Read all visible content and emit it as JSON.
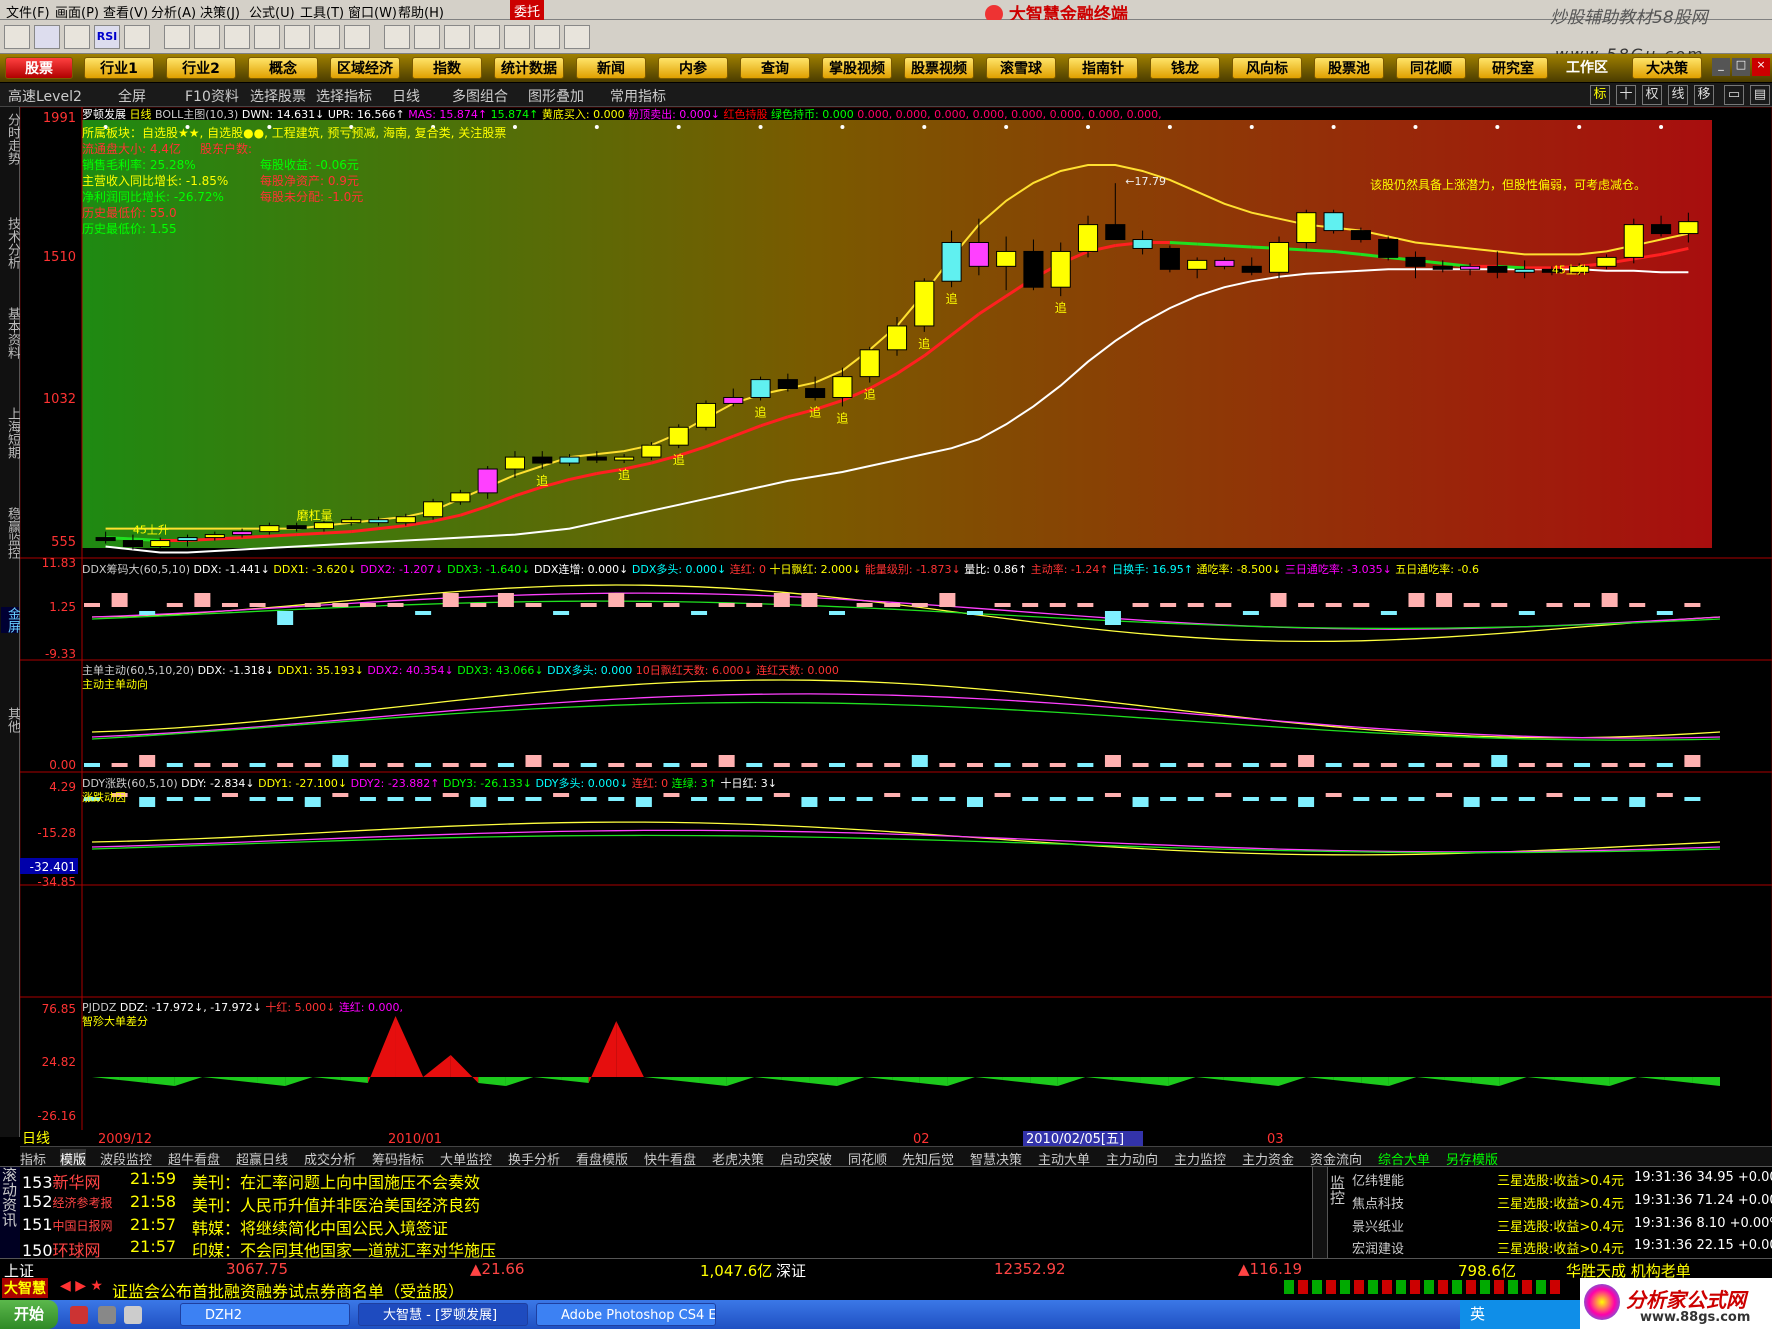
{
  "menu": [
    "文件(F)",
    "画面(P)",
    "查看(V)",
    "分析(A)",
    "决策(J)",
    "公式(U)",
    "工具(T)",
    "窗口(W)",
    "帮助(H)",
    "委托"
  ],
  "app_title": "大智慧金融终端",
  "watermark_site": "炒股辅助教材58股网",
  "watermark_url": "www.58Gu.com",
  "nav": [
    "股票",
    "行业1",
    "行业2",
    "概念",
    "区域经济",
    "指数",
    "统计数据",
    "新闻",
    "内参",
    "查询",
    "掌股视频",
    "股票视频",
    "滚雪球",
    "指南针",
    "钱龙",
    "风向标",
    "股票池",
    "同花顺",
    "研究室",
    "工作区",
    "大决策"
  ],
  "sub": {
    "level2": "高速Level2",
    "full": "全屏",
    "f10": "F10资料",
    "select_stock": "选择股票",
    "select_ind": "选择指标",
    "period": "日线",
    "multi": "多图组合",
    "overlay": "图形叠加",
    "common_ind": "常用指标",
    "right_icons": [
      "标",
      "十",
      "权",
      "线",
      "移"
    ]
  },
  "left_tabs": [
    "分时走势",
    "技术分析",
    "基本资料",
    "上海短期",
    "稳赢监控",
    "金屏",
    "其他"
  ],
  "main": {
    "header_name": "罗顿发展",
    "header_period": "日线",
    "header_ind": "BOLL主图(10,3)",
    "dwn": "DWN: 14.631↓",
    "upr": "UPR: 16.566↑",
    "mas": "MAS: 15.874↑",
    "v2": "15.874↑",
    "buy": "黄底买入: 0.000",
    "sell": "粉顶卖出: 0.000↓",
    "red_hold": "红色持股",
    "green_hold": "绿色持币: 0.000",
    "zeros": "0.000, 0.000, 0.000, 0.000, 0.000, 0.000, 0.000, 0.000,",
    "y_ticks": [
      "1991",
      "1510",
      "1032",
      "555"
    ],
    "info": [
      "所属板块：自选股★★, 自选股●●, 工程建筑, 预亏预减, 海南, 复合类, 关注股票",
      "流通盘大小: 4.4亿",
      "股东户数:",
      "销售毛利率: 25.28%",
      "每股收益: -0.06元",
      "主营收入同比增长: -1.85%",
      "每股净资产: 0.9元",
      "净利润同比增长: -26.72%",
      "每股未分配: -1.0元",
      "历史最低价: 55.0",
      "历史最低价: 1.55"
    ],
    "comment": "该股仍然具备上涨潜力，但股性偏弱，可考虑减仓。",
    "hi_label": "17.79",
    "labels": [
      "追",
      "追",
      "追",
      "追",
      "追",
      "追",
      "追",
      "追",
      "追",
      "追",
      "磨杠量",
      "45上升",
      "45上升"
    ]
  },
  "p2": {
    "header": "DDX筹码大(60,5,10)",
    "ddx": "DDX: -1.441↓",
    "ddx1": "DDX1: -3.620↓",
    "ddx2": "DDX2: -1.207↓",
    "ddx3": "DDX3: -1.640↓",
    "lian": "DDX连增: 0.000↓",
    "duo": "DDX多头: 0.000↓",
    "lianhong": "连红: 0",
    "shiri": "十日飘红: 2.000↓",
    "neng": "能量级别: -1.873↓",
    "liangbi": "量比: 0.86↑",
    "zhudong": "主动率: -1.24↑",
    "huanshou": "日换手: 16.95↑",
    "tongchi": "通吃率: -8.500↓",
    "san": "三日通吃率: -3.035↓",
    "wu": "五日通吃率: -0.6",
    "y_ticks": [
      "11.83",
      "1.25",
      "-9.33"
    ]
  },
  "p3": {
    "header": "主单主动(60,5,10,20)",
    "ddx": "DDX: -1.318↓",
    "ddx1": "DDX1: 35.193↓",
    "ddx2": "DDX2: 40.354↓",
    "ddx3": "DDX3: 43.066↓",
    "duo": "DDX多头: 0.000",
    "ten": "10日飘红天数: 6.000↓",
    "lh": "连红天数: 0.000",
    "sub": "主动主单动向",
    "y_ticks": [
      "0.00"
    ]
  },
  "p4": {
    "header": "DDY涨跌(60,5,10)",
    "ddy": "DDY: -2.834↓",
    "ddy1": "DDY1: -27.100↓",
    "ddy2": "DDY2: -23.882↑",
    "ddy3": "DDY3: -26.133↓",
    "duo": "DDY多头: 0.000↓",
    "lh": "连红: 0",
    "lg": "连绿: 3↑",
    "sr": "十日红: 3↓",
    "sub": "涨跌动因",
    "y_ticks": [
      "4.29",
      "-15.28",
      "-32.401",
      "-34.85"
    ]
  },
  "p5": {
    "header": "PJDDZ",
    "ddz": "DDZ: -17.972↓, -17.972↓",
    "sh": "十红: 5.000↓",
    "lh": "连红: 0.000,",
    "sub": "智殄大单差分",
    "y_ticks": [
      "76.85",
      "24.82",
      "-26.16"
    ]
  },
  "x_axis": {
    "period": "日线",
    "labels": [
      "2009/12",
      "2010/01",
      "02",
      "2010/02/05[五]",
      "03"
    ]
  },
  "bottom_tabs": [
    "指标",
    "模版",
    "波段监控",
    "超牛看盘",
    "超赢日线",
    "成交分析",
    "筹码指标",
    "大单监控",
    "换手分析",
    "看盘模版",
    "快牛看盘",
    "老虎决策",
    "启动突破",
    "同花顺",
    "先知后觉",
    "智慧决策",
    "主动大单",
    "主力动向",
    "主力监控",
    "主力资金",
    "资金流向",
    "综合大单",
    "另存模版"
  ],
  "news": [
    {
      "num": "153",
      "src": "新华网",
      "time": "21:59",
      "text": "美刊：在汇率问题上向中国施压不会奏效"
    },
    {
      "num": "152",
      "src": "经济参考报",
      "time": "21:58",
      "text": "美刊：人民币升值并非医治美国经济良药"
    },
    {
      "num": "151",
      "src": "中国日报网",
      "time": "21:57",
      "text": "韩媒：将继续简化中国公民入境签证"
    },
    {
      "num": "150",
      "src": "环球网",
      "time": "21:57",
      "text": "印媒：不会同其他国家一道就汇率对华施压"
    }
  ],
  "news_side": "滚动资讯",
  "monitor_side": "监控",
  "monitor": [
    {
      "name": "亿纬锂能",
      "signal": "三星选股:收益>0.4元",
      "time": "19:31:36 34.95 +0.00%"
    },
    {
      "name": "焦点科技",
      "signal": "三星选股:收益>0.4元",
      "time": "19:31:36 71.24 +0.00%"
    },
    {
      "name": "景兴纸业",
      "signal": "三星选股:收益>0.4元",
      "time": "19:31:36  8.10 +0.00%"
    },
    {
      "name": "宏润建设",
      "signal": "三星选股:收益>0.4元",
      "time": "19:31:36 22.15 +0.00%"
    }
  ],
  "index": {
    "sh": "上证",
    "sh_val": "3067.75",
    "sh_chg": "▲21.66",
    "sh_amt": "1,047.6亿",
    "sz": "深证",
    "sz_val": "12352.92",
    "sz_chg": "▲116.19",
    "sz_amt": "798.6亿",
    "right": "华胜天成 机构老单"
  },
  "ticker": {
    "logo": "大智慧",
    "text": "证监会公布首批融资融券试点券商名单（受益股）"
  },
  "taskbar": {
    "start": "开始",
    "tasks": [
      "DZH2",
      "大智慧 - [罗顿发展]",
      "Adobe Photoshop CS4 E..."
    ],
    "tray": "英"
  },
  "brand_bottom": "分析家公式网",
  "brand_url": "www.88gs.com",
  "chart_data": {
    "type": "candlestick",
    "title": "罗顿发展 日线 BOLL主图(10,3)",
    "candles": [
      {
        "o": 5.9,
        "h": 6.1,
        "l": 5.7,
        "c": 5.8
      },
      {
        "o": 5.8,
        "h": 6.0,
        "l": 5.5,
        "c": 5.6
      },
      {
        "o": 5.6,
        "h": 5.9,
        "l": 5.5,
        "c": 5.8
      },
      {
        "o": 5.8,
        "h": 6.0,
        "l": 5.6,
        "c": 5.9
      },
      {
        "o": 5.9,
        "h": 6.1,
        "l": 5.8,
        "c": 6.0
      },
      {
        "o": 6.0,
        "h": 6.2,
        "l": 5.9,
        "c": 6.1
      },
      {
        "o": 6.1,
        "h": 6.4,
        "l": 6.0,
        "c": 6.3
      },
      {
        "o": 6.3,
        "h": 6.4,
        "l": 6.1,
        "c": 6.2
      },
      {
        "o": 6.2,
        "h": 6.5,
        "l": 6.1,
        "c": 6.4
      },
      {
        "o": 6.4,
        "h": 6.6,
        "l": 6.3,
        "c": 6.5
      },
      {
        "o": 6.5,
        "h": 6.6,
        "l": 6.3,
        "c": 6.4
      },
      {
        "o": 6.4,
        "h": 6.7,
        "l": 6.3,
        "c": 6.6
      },
      {
        "o": 6.6,
        "h": 7.2,
        "l": 6.5,
        "c": 7.1
      },
      {
        "o": 7.1,
        "h": 7.5,
        "l": 7.0,
        "c": 7.4
      },
      {
        "o": 7.4,
        "h": 8.3,
        "l": 7.2,
        "c": 8.2
      },
      {
        "o": 8.2,
        "h": 8.8,
        "l": 7.9,
        "c": 8.6
      },
      {
        "o": 8.6,
        "h": 8.8,
        "l": 8.2,
        "c": 8.4
      },
      {
        "o": 8.4,
        "h": 8.7,
        "l": 8.3,
        "c": 8.6
      },
      {
        "o": 8.6,
        "h": 8.8,
        "l": 8.4,
        "c": 8.5
      },
      {
        "o": 8.5,
        "h": 8.7,
        "l": 8.4,
        "c": 8.6
      },
      {
        "o": 8.6,
        "h": 9.1,
        "l": 8.5,
        "c": 9.0
      },
      {
        "o": 9.0,
        "h": 9.7,
        "l": 8.9,
        "c": 9.6
      },
      {
        "o": 9.6,
        "h": 10.5,
        "l": 9.5,
        "c": 10.4
      },
      {
        "o": 10.4,
        "h": 10.9,
        "l": 10.3,
        "c": 10.6
      },
      {
        "o": 10.6,
        "h": 11.3,
        "l": 10.5,
        "c": 11.2
      },
      {
        "o": 11.2,
        "h": 11.4,
        "l": 10.8,
        "c": 10.9
      },
      {
        "o": 10.9,
        "h": 11.3,
        "l": 10.5,
        "c": 10.6
      },
      {
        "o": 10.6,
        "h": 11.6,
        "l": 10.3,
        "c": 11.3
      },
      {
        "o": 11.3,
        "h": 12.3,
        "l": 11.1,
        "c": 12.2
      },
      {
        "o": 12.2,
        "h": 13.3,
        "l": 12.0,
        "c": 13.0
      },
      {
        "o": 13.0,
        "h": 14.6,
        "l": 12.8,
        "c": 14.5
      },
      {
        "o": 14.5,
        "h": 16.2,
        "l": 14.3,
        "c": 15.8
      },
      {
        "o": 15.8,
        "h": 16.6,
        "l": 14.7,
        "c": 15.0
      },
      {
        "o": 15.0,
        "h": 16.0,
        "l": 14.2,
        "c": 15.5
      },
      {
        "o": 15.5,
        "h": 15.9,
        "l": 14.2,
        "c": 14.3
      },
      {
        "o": 14.3,
        "h": 15.8,
        "l": 14.0,
        "c": 15.5
      },
      {
        "o": 15.5,
        "h": 16.7,
        "l": 15.3,
        "c": 16.4
      },
      {
        "o": 16.4,
        "h": 17.79,
        "l": 15.9,
        "c": 15.9
      },
      {
        "o": 15.9,
        "h": 16.2,
        "l": 15.4,
        "c": 15.6
      },
      {
        "o": 15.6,
        "h": 15.7,
        "l": 14.8,
        "c": 14.9
      },
      {
        "o": 14.9,
        "h": 15.3,
        "l": 14.6,
        "c": 15.2
      },
      {
        "o": 15.2,
        "h": 15.3,
        "l": 14.9,
        "c": 15.0
      },
      {
        "o": 15.0,
        "h": 15.3,
        "l": 14.7,
        "c": 14.8
      },
      {
        "o": 14.8,
        "h": 16.0,
        "l": 14.6,
        "c": 15.8
      },
      {
        "o": 15.8,
        "h": 16.9,
        "l": 15.6,
        "c": 16.8
      },
      {
        "o": 16.8,
        "h": 16.9,
        "l": 16.1,
        "c": 16.2
      },
      {
        "o": 16.2,
        "h": 16.3,
        "l": 15.8,
        "c": 15.9
      },
      {
        "o": 15.9,
        "h": 16.0,
        "l": 15.2,
        "c": 15.3
      },
      {
        "o": 15.3,
        "h": 15.5,
        "l": 14.6,
        "c": 15.0
      },
      {
        "o": 15.0,
        "h": 15.2,
        "l": 14.8,
        "c": 14.9
      },
      {
        "o": 14.9,
        "h": 15.1,
        "l": 14.7,
        "c": 15.0
      },
      {
        "o": 15.0,
        "h": 15.5,
        "l": 14.6,
        "c": 14.8
      },
      {
        "o": 14.8,
        "h": 15.2,
        "l": 14.6,
        "c": 14.9
      },
      {
        "o": 14.9,
        "h": 15.0,
        "l": 14.7,
        "c": 14.8
      },
      {
        "o": 14.8,
        "h": 15.1,
        "l": 14.7,
        "c": 15.0
      },
      {
        "o": 15.0,
        "h": 15.4,
        "l": 14.9,
        "c": 15.3
      },
      {
        "o": 15.3,
        "h": 16.6,
        "l": 15.1,
        "c": 16.4
      },
      {
        "o": 16.4,
        "h": 16.7,
        "l": 16.0,
        "c": 16.1
      },
      {
        "o": 16.1,
        "h": 16.8,
        "l": 15.8,
        "c": 16.5
      }
    ],
    "upper": [
      6.2,
      6.2,
      6.2,
      6.2,
      6.2,
      6.2,
      6.2,
      6.2,
      6.3,
      6.4,
      6.5,
      6.6,
      6.8,
      7.2,
      7.6,
      8.0,
      8.3,
      8.6,
      8.7,
      8.8,
      9.0,
      9.4,
      9.9,
      10.4,
      10.7,
      10.9,
      11.1,
      11.5,
      12.2,
      13.0,
      14.1,
      15.3,
      16.4,
      17.2,
      17.8,
      18.2,
      18.4,
      18.4,
      18.2,
      17.9,
      17.5,
      17.1,
      16.8,
      16.6,
      16.4,
      16.3,
      16.2,
      16.0,
      15.8,
      15.7,
      15.6,
      15.5,
      15.4,
      15.4,
      15.4,
      15.5,
      15.7,
      15.9,
      16.1
    ],
    "mid": [
      5.9,
      5.85,
      5.8,
      5.8,
      5.85,
      5.9,
      5.95,
      6.0,
      6.05,
      6.1,
      6.2,
      6.3,
      6.45,
      6.65,
      6.95,
      7.3,
      7.6,
      7.85,
      8.05,
      8.2,
      8.4,
      8.65,
      8.95,
      9.3,
      9.65,
      9.95,
      10.2,
      10.5,
      10.9,
      11.4,
      12.0,
      12.7,
      13.4,
      14.0,
      14.6,
      15.1,
      15.5,
      15.7,
      15.8,
      15.8,
      15.75,
      15.7,
      15.65,
      15.6,
      15.55,
      15.5,
      15.4,
      15.3,
      15.2,
      15.1,
      15.0,
      15.0,
      14.95,
      14.95,
      15.0,
      15.1,
      15.25,
      15.4,
      15.6
    ],
    "lower": [
      5.6,
      5.5,
      5.4,
      5.4,
      5.45,
      5.5,
      5.55,
      5.6,
      5.65,
      5.7,
      5.75,
      5.8,
      5.85,
      5.9,
      5.95,
      6.0,
      6.1,
      6.2,
      6.4,
      6.6,
      6.8,
      7.0,
      7.2,
      7.4,
      7.6,
      7.8,
      7.95,
      8.1,
      8.3,
      8.5,
      8.7,
      8.9,
      9.2,
      9.7,
      10.3,
      11.0,
      11.8,
      12.5,
      13.1,
      13.6,
      14.0,
      14.3,
      14.5,
      14.65,
      14.75,
      14.8,
      14.85,
      14.9,
      14.9,
      14.9,
      14.9,
      14.9,
      14.9,
      14.9,
      14.9,
      14.85,
      14.85,
      14.8,
      14.8
    ],
    "ylim": [
      5.55,
      19.91
    ]
  }
}
